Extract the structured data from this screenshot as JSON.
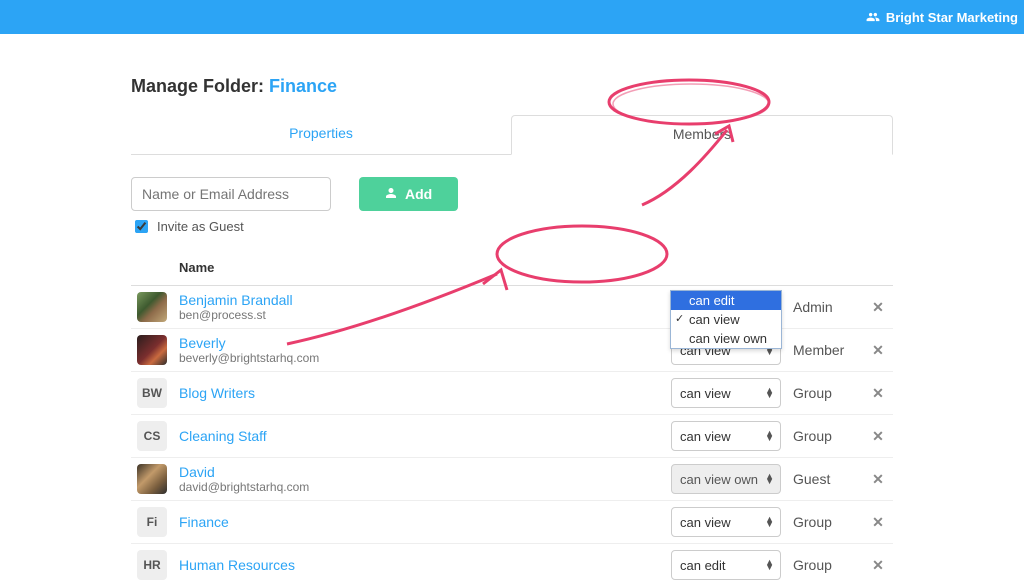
{
  "topbar": {
    "org_name": "Bright Star Marketing"
  },
  "title": {
    "prefix": "Manage Folder: ",
    "folder": "Finance"
  },
  "tabs": {
    "properties": "Properties",
    "members": "Members"
  },
  "invite": {
    "placeholder": "Name or Email Address",
    "add_label": "Add",
    "guest_checkbox_label": "Invite as Guest",
    "guest_checked": true
  },
  "columns": {
    "name": "Name"
  },
  "perm_options": [
    "can edit",
    "can view",
    "can view own"
  ],
  "dropdown_state": {
    "open_row": 0,
    "highlighted": "can edit",
    "checked": "can view"
  },
  "members": [
    {
      "name": "Benjamin Brandall",
      "sub": "ben@process.st",
      "avatar": {
        "kind": "photo",
        "cls": "av-ben"
      },
      "perm": "can edit",
      "role": "Admin",
      "removable": true
    },
    {
      "name": "Beverly",
      "sub": "beverly@brightstarhq.com",
      "avatar": {
        "kind": "photo",
        "cls": "av-bev"
      },
      "perm": "can view",
      "role": "Member",
      "removable": true
    },
    {
      "name": "Blog Writers",
      "sub": "",
      "avatar": {
        "kind": "initials",
        "text": "BW"
      },
      "perm": "can view",
      "role": "Group",
      "removable": true
    },
    {
      "name": "Cleaning Staff",
      "sub": "",
      "avatar": {
        "kind": "initials",
        "text": "CS"
      },
      "perm": "can view",
      "role": "Group",
      "removable": true
    },
    {
      "name": "David",
      "sub": "david@brightstarhq.com",
      "avatar": {
        "kind": "photo",
        "cls": "av-dav"
      },
      "perm": "can view own",
      "role": "Guest",
      "removable": true,
      "perm_disabled": true
    },
    {
      "name": "Finance",
      "sub": "",
      "avatar": {
        "kind": "initials",
        "text": "Fi"
      },
      "perm": "can view",
      "role": "Group",
      "removable": true
    },
    {
      "name": "Human Resources",
      "sub": "",
      "avatar": {
        "kind": "initials",
        "text": "HR"
      },
      "perm": "can edit",
      "role": "Group",
      "removable": true
    }
  ]
}
